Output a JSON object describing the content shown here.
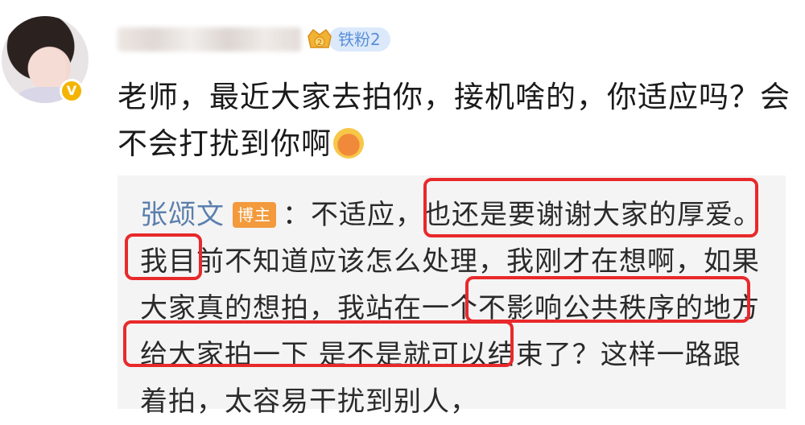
{
  "user": {
    "fan_badge_label": "铁粉2",
    "verified_label": "V"
  },
  "comment": {
    "text": "老师，最近大家去拍你，接机啥的，你适应吗？会不会打扰到你啊"
  },
  "reply": {
    "author": "张颂文",
    "owner_tag": "博主",
    "text": "：不适应，也还是要谢谢大家的厚爱。我目前不知道应该怎么处理，我刚才在想啊，如果大家真的想拍，我站在一个不影响公共秩序的地方给大家拍一下 是不是就可以结束了？这样一路跟着拍，太容易干扰到别人，"
  },
  "colors": {
    "highlight_border": "#e8292b",
    "author_link": "#5b7fae",
    "owner_tag_bg": "#f39a3c",
    "fan_badge_bg": "#dbe9fb"
  }
}
